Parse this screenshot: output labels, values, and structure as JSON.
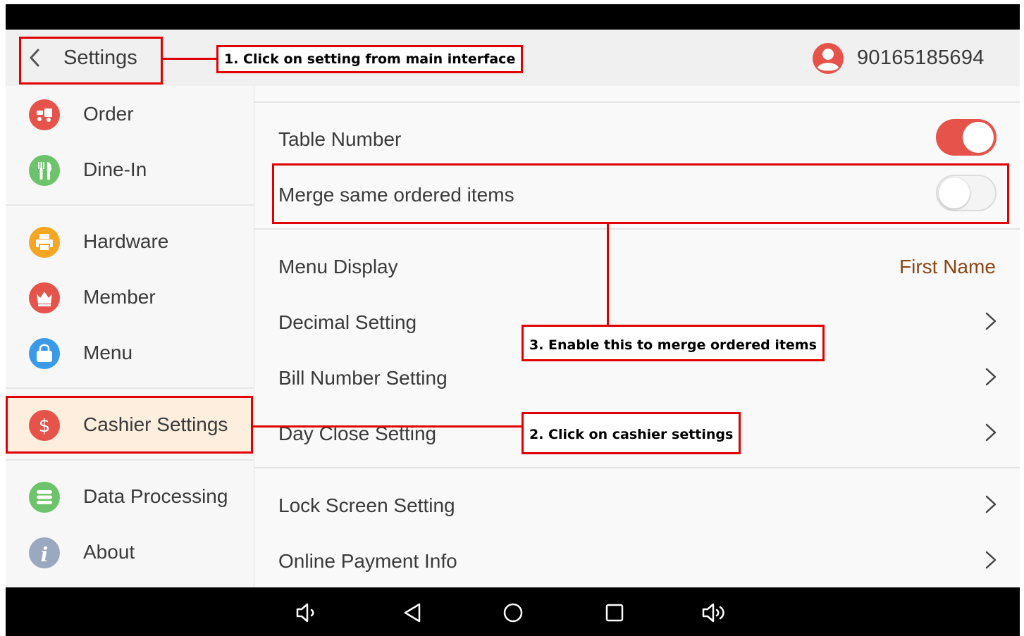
{
  "app_bar": {
    "title": "Settings",
    "phone": "90165185694"
  },
  "sidebar": {
    "items": [
      {
        "label": "Order",
        "icon": "order-icon",
        "color": "#e5534b"
      },
      {
        "label": "Dine-In",
        "icon": "fork-knife-icon",
        "color": "#6cc36b"
      },
      {
        "label": "Hardware",
        "icon": "printer-icon",
        "color": "#f5a623"
      },
      {
        "label": "Member",
        "icon": "crown-icon",
        "color": "#e5534b"
      },
      {
        "label": "Menu",
        "icon": "bag-icon",
        "color": "#3a9ae8"
      },
      {
        "label": "Cashier Settings",
        "icon": "dollar-icon",
        "color": "#e5534b",
        "active": true
      },
      {
        "label": "Data Processing",
        "icon": "database-icon",
        "color": "#6cc36b"
      },
      {
        "label": "About",
        "icon": "info-icon",
        "color": "#9aa8c0"
      }
    ]
  },
  "settings": {
    "table_number": {
      "label": "Table Number",
      "enabled": true
    },
    "merge_items": {
      "label": "Merge same ordered items",
      "enabled": false
    },
    "menu_display": {
      "label": "Menu Display",
      "value": "First Name"
    },
    "decimal": {
      "label": "Decimal Setting"
    },
    "bill_number": {
      "label": "Bill Number Setting"
    },
    "day_close": {
      "label": "Day Close Setting"
    },
    "lock_screen": {
      "label": "Lock Screen Setting"
    },
    "online_payment": {
      "label": "Online Payment Info"
    }
  },
  "annotations": {
    "step1": "1. Click on setting from main interface",
    "step2": "2. Click on cashier settings",
    "step3": "3. Enable this to merge ordered items"
  },
  "colors": {
    "accent": "#e5534b",
    "annotation": "#e00000",
    "active_bg": "#fdeede",
    "value_text": "#8b4513"
  }
}
